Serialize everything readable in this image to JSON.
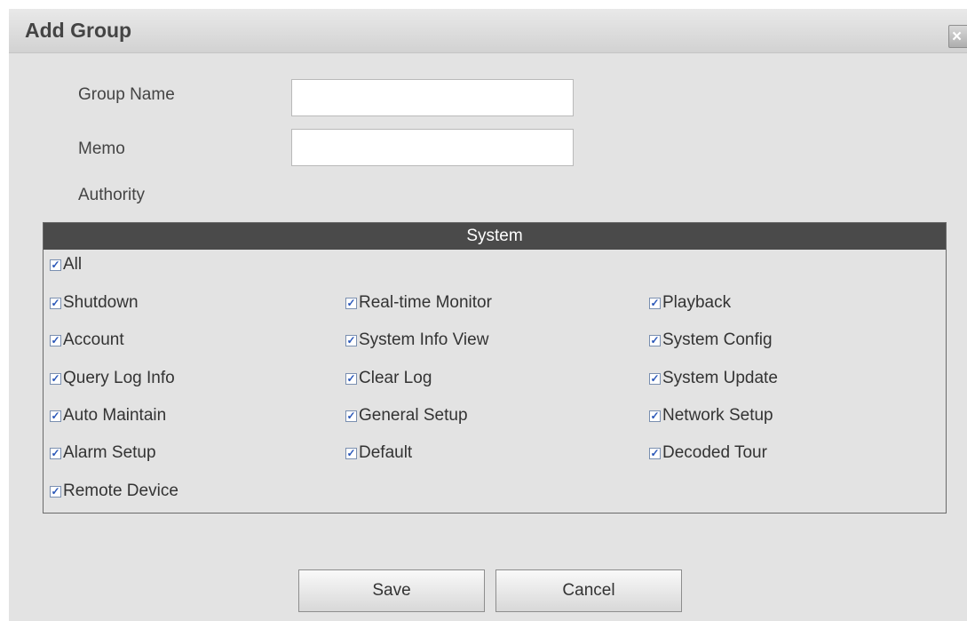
{
  "dialog": {
    "title": "Add Group",
    "close_glyph": "×"
  },
  "form": {
    "group_name_label": "Group Name",
    "group_name_value": "",
    "memo_label": "Memo",
    "memo_value": "",
    "authority_label": "Authority"
  },
  "permissions": {
    "header": "System",
    "check_glyph": "✓",
    "items": [
      {
        "label": "All",
        "checked": true
      },
      {
        "label": "Shutdown",
        "checked": true
      },
      {
        "label": "Real-time Monitor",
        "checked": true
      },
      {
        "label": "Playback",
        "checked": true
      },
      {
        "label": "Account",
        "checked": true
      },
      {
        "label": "System Info View",
        "checked": true
      },
      {
        "label": "System Config",
        "checked": true
      },
      {
        "label": "Query Log Info",
        "checked": true
      },
      {
        "label": "Clear Log",
        "checked": true
      },
      {
        "label": "System Update",
        "checked": true
      },
      {
        "label": "Auto Maintain",
        "checked": true
      },
      {
        "label": "General Setup",
        "checked": true
      },
      {
        "label": "Network Setup",
        "checked": true
      },
      {
        "label": "Alarm Setup",
        "checked": true
      },
      {
        "label": "Default",
        "checked": true
      },
      {
        "label": "Decoded Tour",
        "checked": true
      },
      {
        "label": "Remote Device",
        "checked": true
      }
    ]
  },
  "buttons": {
    "save": "Save",
    "cancel": "Cancel"
  }
}
